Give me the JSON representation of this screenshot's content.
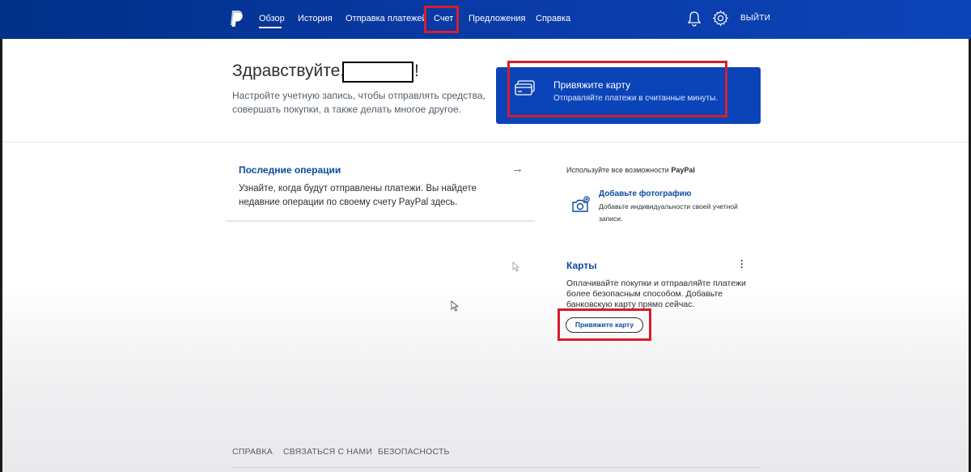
{
  "header": {
    "nav": [
      {
        "label": "Обзор",
        "active": true
      },
      {
        "label": "История",
        "active": false
      },
      {
        "label": "Отправка платежей",
        "active": false
      },
      {
        "label": "Счет",
        "active": false,
        "highlighted": true
      },
      {
        "label": "Предложения",
        "active": false
      },
      {
        "label": "Справка",
        "active": false
      }
    ],
    "logout": "ВЫЙТИ"
  },
  "greeting": {
    "hello": "Здравствуйте,",
    "exclamation": "!",
    "subtitle": "Настройте учетную запись, чтобы отправлять средства, совершать покупки, а также делать многое другое."
  },
  "promo": {
    "title": "Привяжите карту",
    "subtitle": "Отправляйте платежи в считанные минуты."
  },
  "recent": {
    "title": "Последние операции",
    "body": "Узнайте, когда будут отправлены платежи. Вы найдете недавние операции по своему счету PayPal здесь."
  },
  "features": {
    "intro": "Используйте все возможности",
    "brand": "PayPal",
    "photo_title": "Добавьте фотографию",
    "photo_sub": "Добавьте индивидуальности своей учетной записи."
  },
  "cards": {
    "title": "Карты",
    "body": "Оплачивайте покупки и отправляйте платежи более безопасным способом. Добавьте банковскую карту прямо сейчас.",
    "button": "Привяжите карту"
  },
  "footer": {
    "links": [
      "СПРАВКА",
      "СВЯЗАТЬСЯ С НАМИ",
      "БЕЗОПАСНОСТЬ"
    ]
  },
  "colors": {
    "header": "#0a3aa6",
    "promo": "#0a44b8",
    "link": "#0b4a9f",
    "highlight": "#d41e2b"
  },
  "icons": [
    "paypal-logo-icon",
    "bell-icon",
    "gear-icon",
    "card-icon",
    "camera-plus-icon",
    "arrow-right-icon",
    "kebab-menu-icon",
    "mouse-cursor-icon"
  ]
}
